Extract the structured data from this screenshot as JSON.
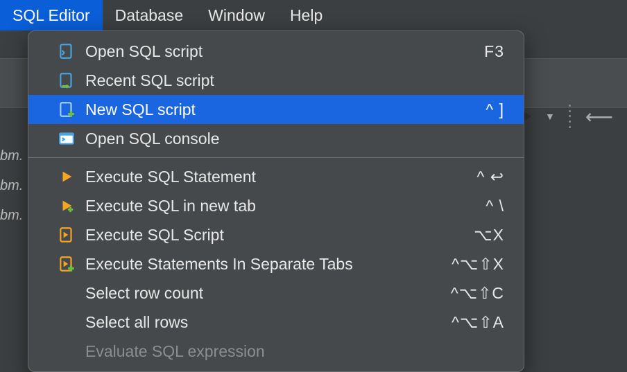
{
  "menubar": {
    "items": [
      {
        "label": "SQL Editor",
        "active": true
      },
      {
        "label": "Database",
        "active": false
      },
      {
        "label": "Window",
        "active": false
      },
      {
        "label": "Help",
        "active": false
      }
    ]
  },
  "dropdown": {
    "group1": [
      {
        "icon": "sql-open-icon",
        "label": "Open SQL script",
        "shortcut": "F3"
      },
      {
        "icon": "sql-recent-icon",
        "label": "Recent SQL script",
        "shortcut": ""
      },
      {
        "icon": "sql-new-icon",
        "label": "New SQL script",
        "shortcut": "^ ]",
        "highlight": true
      },
      {
        "icon": "sql-console-icon",
        "label": "Open SQL console",
        "shortcut": ""
      }
    ],
    "group2": [
      {
        "icon": "execute-icon",
        "label": "Execute SQL Statement",
        "shortcut": "^ ↩"
      },
      {
        "icon": "execute-newtab-icon",
        "label": "Execute SQL in new tab",
        "shortcut": "^ \\"
      },
      {
        "icon": "execute-script-icon",
        "label": "Execute SQL Script",
        "shortcut": "⌥X"
      },
      {
        "icon": "execute-tabs-icon",
        "label": "Execute Statements In Separate Tabs",
        "shortcut": "^⌥⇧X"
      },
      {
        "icon": "",
        "label": "Select row count",
        "shortcut": "^⌥⇧C"
      },
      {
        "icon": "",
        "label": "Select all rows",
        "shortcut": "^⌥⇧A"
      },
      {
        "icon": "",
        "label": "Evaluate SQL expression",
        "shortcut": "",
        "disabled": true
      }
    ]
  },
  "bg": {
    "leftItems": [
      "bm.",
      "bm.",
      "bm."
    ]
  }
}
